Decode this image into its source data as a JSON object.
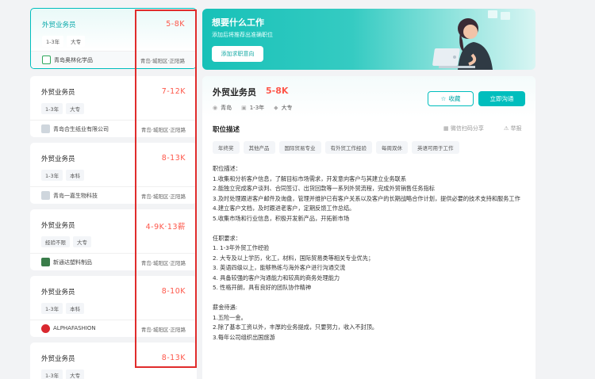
{
  "jobs": [
    {
      "title": "外贸业务员",
      "salary": "5-8K",
      "tags": [
        "1-3年",
        "大专"
      ],
      "company": "青岛奥林化学品",
      "location": "青岛·城阳区·正阳路",
      "logo_color": "#2fa85c"
    },
    {
      "title": "外贸业务员",
      "salary": "7-12K",
      "tags": [
        "1-3年",
        "大专"
      ],
      "company": "青岛合生纸业有限公司",
      "location": "青岛·城阳区·正阳路",
      "logo_color": "#cfd6dd"
    },
    {
      "title": "外贸业务员",
      "salary": "8-13K",
      "tags": [
        "1-3年",
        "本科"
      ],
      "company": "青岛一嘉生物科技",
      "location": "青岛·城阳区·正阳路",
      "logo_color": "#cfd6dd"
    },
    {
      "title": "外贸业务员",
      "salary": "4-9K·13薪",
      "tags": [
        "经验不限",
        "大专"
      ],
      "company": "新通达塑料制品",
      "location": "青岛·城阳区·正阳路",
      "logo_color": "#3a7d4a"
    },
    {
      "title": "外贸业务员",
      "salary": "8-10K",
      "tags": [
        "1-3年",
        "本科"
      ],
      "company": "ALPHAFASHION",
      "location": "青岛·城阳区·正阳路",
      "logo_color": "#d9282f"
    },
    {
      "title": "外贸业务员",
      "salary": "8-13K",
      "tags": [
        "1-3年",
        "大专"
      ],
      "company": "",
      "location": "",
      "logo_color": "#cfd6dd"
    }
  ],
  "banner": {
    "title": "想要什么工作",
    "subtitle": "添加后将推荐出准确职位",
    "button": "添加求职意向"
  },
  "detail": {
    "title": "外贸业务员",
    "salary": "5-8K",
    "city": "青岛",
    "experience": "1-3年",
    "education": "大专",
    "collect": "收藏",
    "chat": "立即沟通",
    "section": "职位描述",
    "share": "微信扫码分享",
    "report": "举报",
    "skills": [
      "年终奖",
      "其他产品",
      "国际贸易专业",
      "有外贸工作经验",
      "每周双休",
      "英语可用于工作"
    ],
    "description": "职位描述：\n1.收集和分析客户信息，了解目标市场需求，开发意向客户与其建立业务联系\n2.能独立完成客户谈判、合同签订、出货回款等一系列外贸流程，完成外贸销售任务指标\n3.及时处理跟进客户邮件及询盘，管理并维护已有客户关系以及客户的长期战略合作计划，提供必要的技术支持和服务工作\n4.建立客户文档，及时跟进老客户，定期反馈工作总结。\n5.收集市场和行业信息，积极开发新产品，开拓新市场\n\n任职要求：\n1. 1-3年外贸工作经验\n2. 大专及以上学历，化工，材料，国际贸易类等相关专业优先；\n3. 英语四级以上，能够熟练与海外客户进行沟通交流\n4. 具备较强的客户沟通能力和较高的商务处理能力\n5. 性格开朗，具有良好的团队协作精神\n\n薪金待遇:\n1.五险一金。\n2.除了基本工资以外，丰厚的业务提成，只要努力，收入不封顶。\n3.每年公司组织出国旅游"
  }
}
